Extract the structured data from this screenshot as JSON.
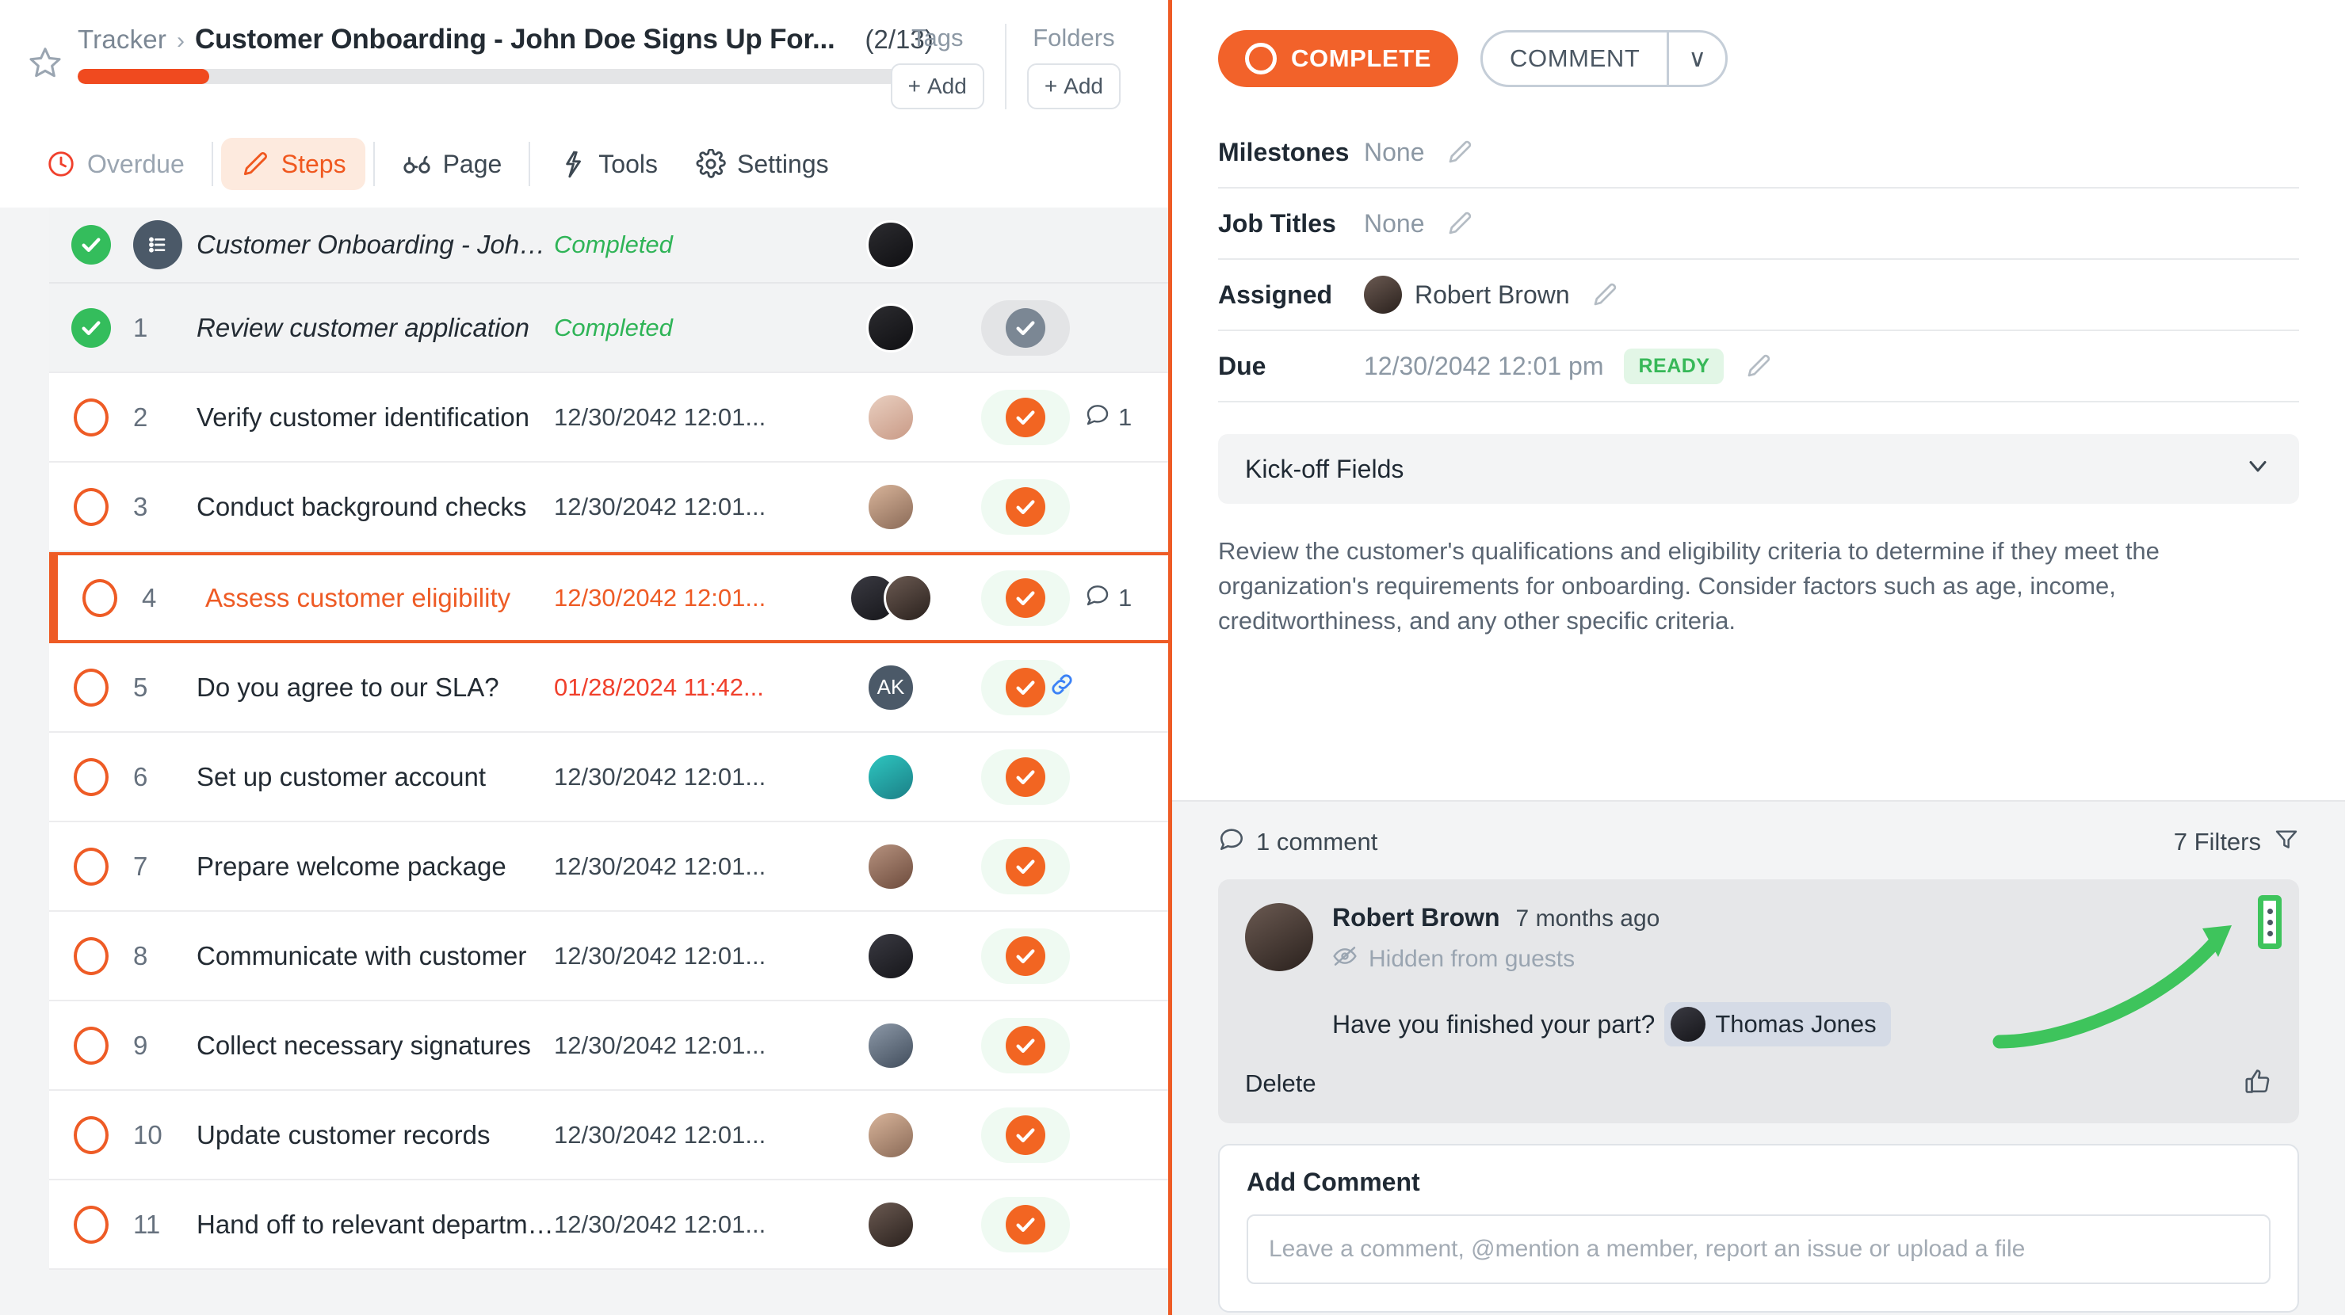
{
  "header": {
    "breadcrumb_root": "Tracker",
    "breadcrumb_sep": "›",
    "title": "Customer Onboarding - John Doe Signs Up For...",
    "count": "(2/13)",
    "progress_percent": 16,
    "tags_label": "Tags",
    "tags_add": "Add",
    "folders_label": "Folders",
    "folders_add": "Add",
    "plus": "+"
  },
  "tabs": [
    {
      "label": "Overdue",
      "icon": "clock-icon",
      "state": "muted"
    },
    {
      "label": "Steps",
      "icon": "pencil-icon",
      "state": "active"
    },
    {
      "label": "Page",
      "icon": "glasses-icon",
      "state": "normal"
    },
    {
      "label": "Tools",
      "icon": "lightning-icon",
      "state": "normal"
    },
    {
      "label": "Settings",
      "icon": "gear-icon",
      "state": "normal"
    }
  ],
  "steps": {
    "parent": {
      "name": "Customer Onboarding - John Do...",
      "status": "Completed",
      "avatar": "grad-a"
    },
    "rows": [
      {
        "index": "1",
        "name": "Review customer application",
        "date": "Completed",
        "date_style": "italic",
        "state": "done",
        "avatars": [
          "grad-a"
        ],
        "action": "grey",
        "comments": "",
        "link": false,
        "selected": false,
        "shade": true
      },
      {
        "index": "2",
        "name": "Verify customer identification",
        "date": "12/30/2042 12:01...",
        "date_style": "plain",
        "state": "open",
        "avatars": [
          "grad-b"
        ],
        "action": "green",
        "comments": "1",
        "link": false,
        "selected": false,
        "shade": false
      },
      {
        "index": "3",
        "name": "Conduct background checks",
        "date": "12/30/2042 12:01...",
        "date_style": "plain",
        "state": "open",
        "avatars": [
          "grad-c"
        ],
        "action": "green",
        "comments": "",
        "link": false,
        "selected": false,
        "shade": false
      },
      {
        "index": "4",
        "name": "Assess customer eligibility",
        "date": "12/30/2042 12:01...",
        "date_style": "orange",
        "state": "open",
        "avatars": [
          "grad-g",
          "grad-h"
        ],
        "action": "green",
        "comments": "1",
        "link": false,
        "selected": true,
        "shade": false
      },
      {
        "index": "5",
        "name": "Do you agree to our SLA?",
        "date": "01/28/2024 11:42...",
        "date_style": "red",
        "state": "open",
        "avatars": [
          "AK"
        ],
        "action": "green",
        "comments": "",
        "link": true,
        "selected": false,
        "shade": false
      },
      {
        "index": "6",
        "name": "Set up customer account",
        "date": "12/30/2042 12:01...",
        "date_style": "plain",
        "state": "open",
        "avatars": [
          "grad-d"
        ],
        "action": "green",
        "comments": "",
        "link": false,
        "selected": false,
        "shade": false
      },
      {
        "index": "7",
        "name": "Prepare welcome package",
        "date": "12/30/2042 12:01...",
        "date_style": "plain",
        "state": "open",
        "avatars": [
          "grad-e"
        ],
        "action": "green",
        "comments": "",
        "link": false,
        "selected": false,
        "shade": false
      },
      {
        "index": "8",
        "name": "Communicate with customer",
        "date": "12/30/2042 12:01...",
        "date_style": "plain",
        "state": "open",
        "avatars": [
          "grad-g"
        ],
        "action": "green",
        "comments": "",
        "link": false,
        "selected": false,
        "shade": false
      },
      {
        "index": "9",
        "name": "Collect necessary signatures",
        "date": "12/30/2042 12:01...",
        "date_style": "plain",
        "state": "open",
        "avatars": [
          "grad-f"
        ],
        "action": "green",
        "comments": "",
        "link": false,
        "selected": false,
        "shade": false
      },
      {
        "index": "10",
        "name": "Update customer records",
        "date": "12/30/2042 12:01...",
        "date_style": "plain",
        "state": "open",
        "avatars": [
          "grad-c"
        ],
        "action": "green",
        "comments": "",
        "link": false,
        "selected": false,
        "shade": false
      },
      {
        "index": "11",
        "name": "Hand off to relevant department",
        "date": "12/30/2042 12:01...",
        "date_style": "plain",
        "state": "open",
        "avatars": [
          "grad-h"
        ],
        "action": "green",
        "comments": "",
        "link": false,
        "selected": false,
        "shade": false
      }
    ]
  },
  "detail": {
    "complete_button": "COMPLETE",
    "comment_button": "COMMENT",
    "caret": "∨",
    "meta": [
      {
        "label": "Milestones",
        "value": "None"
      },
      {
        "label": "Job Titles",
        "value": "None"
      },
      {
        "label": "Assigned",
        "value": "Robert Brown"
      },
      {
        "label": "Due",
        "value": "12/30/2042 12:01 pm",
        "badge": "READY"
      }
    ],
    "kickoff_title": "Kick-off Fields",
    "description": "Review the customer's qualifications and eligibility criteria to determine if they meet the organization's requirements for onboarding. Consider factors such as age, income, creditworthiness, and any other specific criteria."
  },
  "comments": {
    "count_label": "1 comment",
    "filters_label": "7 Filters",
    "item": {
      "author": "Robert Brown",
      "time": "7 months ago",
      "visibility": "Hidden from guests",
      "text": "Have you finished your part?",
      "mention": "Thomas Jones",
      "delete_label": "Delete"
    },
    "add_title": "Add Comment",
    "add_placeholder": "Leave a comment, @mention a member, report an issue or upload a file"
  },
  "colors": {
    "accent_orange": "#ee5b25",
    "complete_orange": "#f2622a",
    "done_green": "#34bd5c",
    "annotation_green": "#3ec45c",
    "overdue_red": "#f0402c"
  }
}
